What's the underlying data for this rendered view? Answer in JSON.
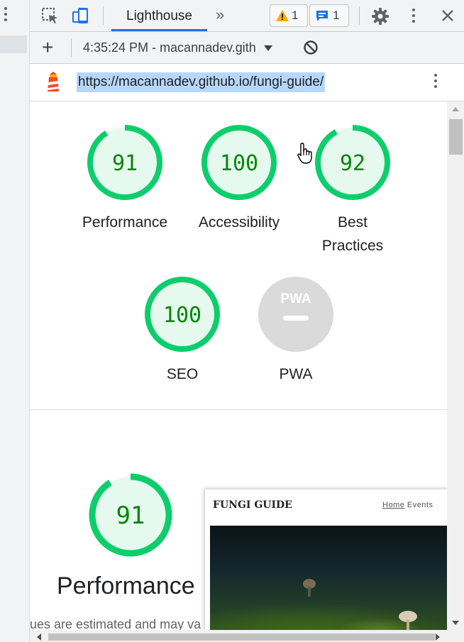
{
  "devtools": {
    "tabs": {
      "current": "Lighthouse",
      "more": "»"
    },
    "badges": {
      "warnings": "1",
      "messages": "1"
    }
  },
  "toolbar": {
    "add": "+",
    "report_select": "4:35:24 PM - macannadev.gith"
  },
  "urlbar": {
    "url": "https://macannadev.github.io/fungi-guide/"
  },
  "scores": [
    {
      "label": "Performance",
      "value": "91",
      "fraction": 0.91
    },
    {
      "label": "Accessibility",
      "value": "100",
      "fraction": 1.0
    },
    {
      "label_line1": "Best",
      "label_line2": "Practices",
      "value": "92",
      "fraction": 0.92
    },
    {
      "label": "SEO",
      "value": "100",
      "fraction": 1.0
    },
    {
      "label": "PWA",
      "badge_text": "PWA"
    }
  ],
  "performance_section": {
    "score": "91",
    "score_fraction": 0.91,
    "title": "Performance",
    "note": "ues are estimated and may va"
  },
  "preview": {
    "logo": "FUNGI GUIDE",
    "nav_home": "Home",
    "nav_events": "Events"
  },
  "colors": {
    "pass_green": "#0cce6b",
    "pass_fill": "#e6f9ee",
    "pass_text": "#008800",
    "accent": "#1a73e8",
    "url_highlight": "#b6d7fa"
  }
}
